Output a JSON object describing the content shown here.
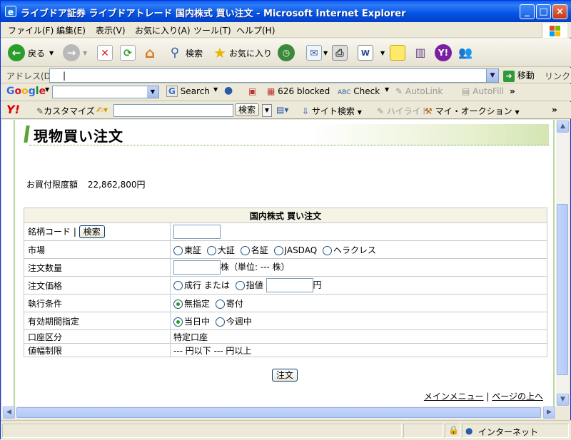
{
  "window": {
    "title": "ライブドア証券 ライブドアトレード 国内株式 買い注文 - Microsoft Internet Explorer"
  },
  "menu": [
    "ファイル(F)",
    "編集(E)",
    "表示(V)",
    "お気に入り(A)",
    "ツール(T)",
    "ヘルプ(H)"
  ],
  "toolbar": {
    "back": "戻る",
    "search": "検索",
    "favorites": "お気に入り"
  },
  "address": {
    "label": "アドレス(D)",
    "value": "|",
    "go": "移動",
    "links": "リンク"
  },
  "google": {
    "logo": "Google",
    "search": "Search",
    "blocked": "626 blocked",
    "check": "Check",
    "autolink": "AutoLink",
    "autofill": "AutoFill"
  },
  "yahoo": {
    "customize": "カスタマイズ",
    "search_btn": "検索",
    "site_search": "サイト検索",
    "highlight": "ハイライト",
    "auction": "マイ・オークション"
  },
  "page": {
    "heading": "現物買い注文",
    "limit_label": "お買付限度額",
    "limit_value": "22,862,800円",
    "table_title": "国内株式 買い注文",
    "rows": {
      "code_label": "銘柄コード",
      "code_sep": "|",
      "code_search": "検索",
      "market_label": "市場",
      "markets": [
        "東証",
        "大証",
        "名証",
        "JASDAQ",
        "ヘラクレス"
      ],
      "qty_label": "注文数量",
      "qty_unit": "株（単位: --- 株）",
      "price_label": "注文価格",
      "price_market": "成行 または",
      "price_limit": "指値",
      "price_unit": "円",
      "cond_label": "執行条件",
      "conds": [
        "無指定",
        "寄付"
      ],
      "cond_selected": "無指定",
      "period_label": "有効期間指定",
      "periods": [
        "当日中",
        "今週中"
      ],
      "period_selected": "当日中",
      "account_label": "口座区分",
      "account_value": "特定口座",
      "range_label": "値幅制限",
      "range_value": "--- 円以下 --- 円以上"
    },
    "order_btn": "注文",
    "link_main": "メインメニュー",
    "link_sep": "|",
    "link_top": "ページの上へ"
  },
  "status": {
    "zone": "インターネット"
  }
}
